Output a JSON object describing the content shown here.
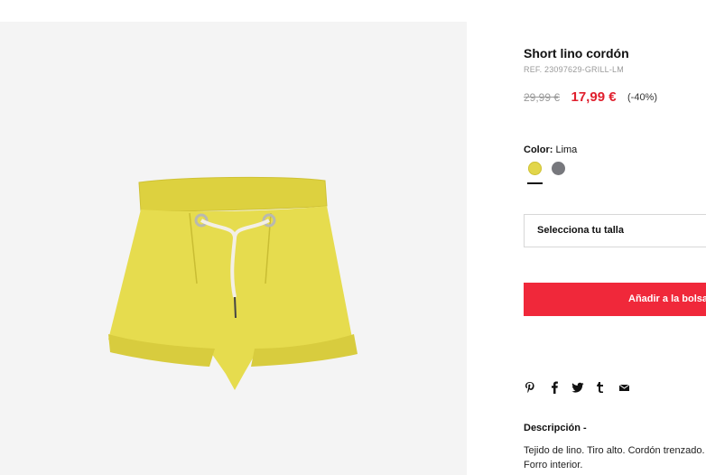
{
  "product": {
    "title": "Short lino cordón",
    "ref": "REF. 23097629-GRILL-LM",
    "old_price": "29,99 €",
    "new_price": "17,99 €",
    "discount": "(-40%)",
    "image_alt": "shorts-yellow-linen"
  },
  "color": {
    "label": "Color:",
    "selected": "Lima",
    "swatches": [
      {
        "name": "Lima",
        "hex": "#e2d64a"
      },
      {
        "name": "Gris",
        "hex": "#77787d"
      }
    ]
  },
  "size_select": {
    "placeholder": "Selecciona tu talla"
  },
  "add_to_bag": {
    "label": "Añadir a la bolsa"
  },
  "share_icons": [
    "pinterest-icon",
    "facebook-icon",
    "twitter-icon",
    "tumblr-icon",
    "mail-icon"
  ],
  "description": {
    "title": "Descripción -",
    "line1": "Tejido de lino. Tiro alto. Cordón trenzado.",
    "line2": "Forro interior."
  },
  "colors": {
    "accent_red": "#e0202e",
    "button_red": "#f0283a",
    "panel_bg": "#f4f4f4",
    "product_yellow": "#e3d94a"
  }
}
